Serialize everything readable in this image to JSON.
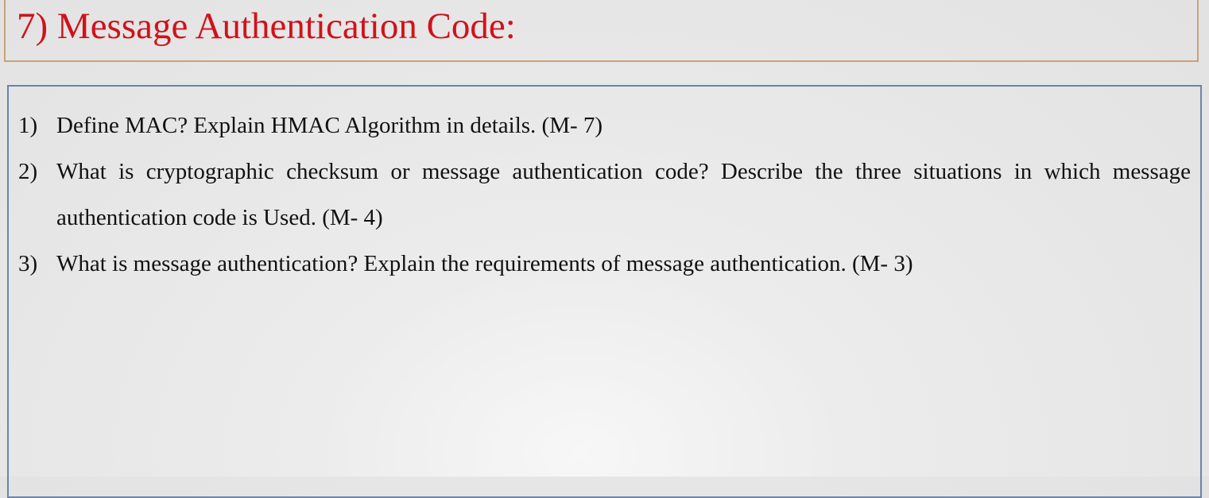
{
  "title": "7)  Message Authentication Code:",
  "questions": [
    {
      "num": "1)",
      "text": "Define MAC? Explain HMAC Algorithm in details. (M- 7)"
    },
    {
      "num": "2)",
      "text": "What is cryptographic checksum or message authentication code? Describe the three situations in which message authentication code is Used. (M- 4)"
    },
    {
      "num": "3)",
      "text": "What is message authentication? Explain the requirements of message authentication. (M- 3)"
    }
  ]
}
